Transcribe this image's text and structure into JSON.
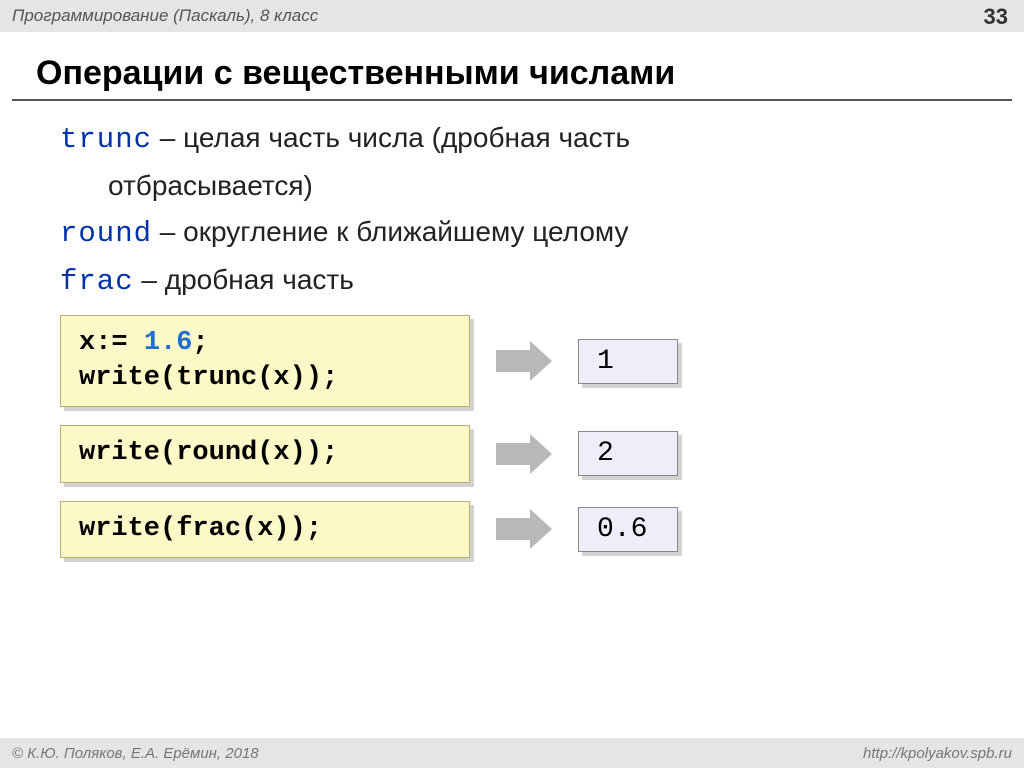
{
  "header": {
    "title": "Программирование (Паскаль), 8 класс",
    "page_number": "33"
  },
  "main_title": "Операции с вещественными числами",
  "definitions": [
    {
      "keyword": "trunc",
      "text1": " – целая часть числа (дробная часть",
      "text2": "отбрасывается)"
    },
    {
      "keyword": "round",
      "text1": " – округление к ближайшему целому",
      "text2": ""
    },
    {
      "keyword": "frac",
      "text1": " – дробная часть",
      "text2": ""
    }
  ],
  "rows": [
    {
      "code_pre": "x:= ",
      "code_value": "1.6",
      "code_post": ";\nwrite(trunc(x));",
      "result": "1"
    },
    {
      "code_pre": "",
      "code_value": "",
      "code_post": "write(round(x));",
      "result": "2"
    },
    {
      "code_pre": "",
      "code_value": "",
      "code_post": "write(frac(x));",
      "result": "0.6"
    }
  ],
  "footer": {
    "left": "© К.Ю. Поляков, Е.А. Ерёмин, 2018",
    "right": "http://kpolyakov.spb.ru"
  }
}
